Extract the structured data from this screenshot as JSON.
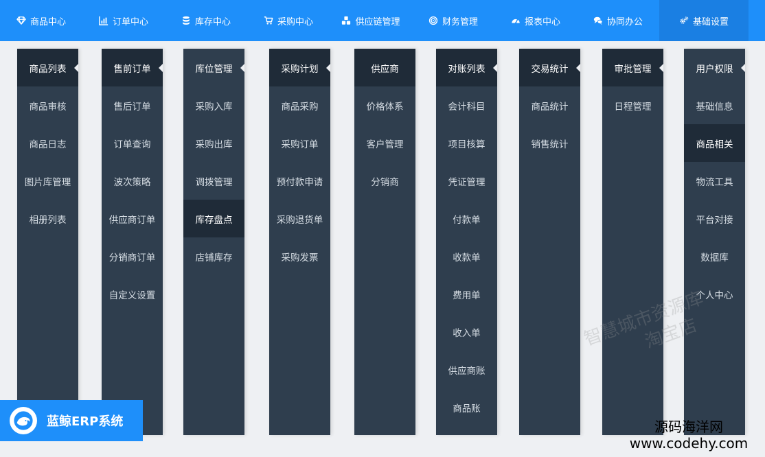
{
  "nav": {
    "items": [
      {
        "label": "商品中心",
        "icon": "diamond-icon"
      },
      {
        "label": "订单中心",
        "icon": "bar-chart-icon"
      },
      {
        "label": "库存中心",
        "icon": "database-icon"
      },
      {
        "label": "采购中心",
        "icon": "cart-icon"
      },
      {
        "label": "供应链管理",
        "icon": "cubes-icon"
      },
      {
        "label": "财务管理",
        "icon": "target-icon"
      },
      {
        "label": "报表中心",
        "icon": "dashboard-icon"
      },
      {
        "label": "协同办公",
        "icon": "chat-icon"
      },
      {
        "label": "基础设置",
        "icon": "cogs-icon"
      }
    ]
  },
  "columns": [
    {
      "header": "商品列表",
      "items": [
        "商品审核",
        "商品日志",
        "图片库管理",
        "相册列表"
      ]
    },
    {
      "header": "售前订单",
      "items": [
        "售后订单",
        "订单查询",
        "波次策略",
        "供应商订单",
        "分销商订单",
        "自定义设置"
      ]
    },
    {
      "header": "库位管理",
      "items": [
        "采购入库",
        "采购出库",
        "调拨管理",
        "库存盘点",
        "店铺库存"
      ]
    },
    {
      "header": "采购计划",
      "items": [
        "商品采购",
        "采购订单",
        "预付款申请",
        "采购退货单",
        "采购发票"
      ]
    },
    {
      "header": "供应商",
      "items": [
        "价格体系",
        "客户管理",
        "分销商"
      ]
    },
    {
      "header": "对账列表",
      "items": [
        "会计科目",
        "项目核算",
        "凭证管理",
        "付款单",
        "收款单",
        "费用单",
        "收入单",
        "供应商账",
        "商品账"
      ]
    },
    {
      "header": "交易统计",
      "items": [
        "商品统计",
        "销售统计"
      ]
    },
    {
      "header": "审批管理",
      "items": [
        "日程管理"
      ]
    },
    {
      "header": "用户权限",
      "items": [
        "基础信息",
        "商品相关",
        "物流工具",
        "平台对接",
        "数据库",
        "个人中心"
      ]
    }
  ],
  "logo": {
    "title": "蓝鲸ERP系统"
  },
  "watermark": {
    "line1": "智慧城市资源库",
    "line2": "淘宝店",
    "site_name": "源码海洋网",
    "site_url": "www.codehy.com"
  },
  "colors": {
    "accent": "#1e8ffa",
    "panel": "#2f3e4e",
    "panel_active": "#1f2b38"
  }
}
